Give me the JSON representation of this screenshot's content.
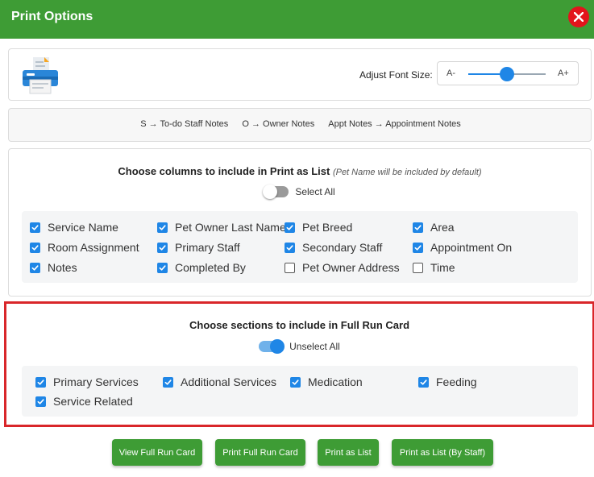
{
  "header": {
    "title": "Print Options"
  },
  "font_size": {
    "label": "Adjust Font Size:",
    "min_label": "A-",
    "max_label": "A+",
    "level": 0.5
  },
  "legend": [
    "S → To-do Staff Notes",
    "O → Owner Notes",
    "Appt Notes → Appointment Notes"
  ],
  "columns_section": {
    "title": "Choose columns to include in Print as List",
    "note": "(Pet Name will be included by default)",
    "toggle_label": "Select All",
    "toggle_on": false,
    "options": [
      {
        "label": "Service Name",
        "checked": true
      },
      {
        "label": "Pet Owner Last Name",
        "checked": true
      },
      {
        "label": "Pet Breed",
        "checked": true
      },
      {
        "label": "Area",
        "checked": true
      },
      {
        "label": "Room Assignment",
        "checked": true
      },
      {
        "label": "Primary Staff",
        "checked": true
      },
      {
        "label": "Secondary Staff",
        "checked": true
      },
      {
        "label": "Appointment On",
        "checked": true
      },
      {
        "label": "Notes",
        "checked": true
      },
      {
        "label": "Completed By",
        "checked": true
      },
      {
        "label": "Pet Owner Address",
        "checked": false
      },
      {
        "label": "Time",
        "checked": false
      }
    ]
  },
  "run_card_section": {
    "title": "Choose sections to include in Full Run Card",
    "toggle_label": "Unselect All",
    "toggle_on": true,
    "options": [
      {
        "label": "Primary Services",
        "checked": true
      },
      {
        "label": "Additional Services",
        "checked": true
      },
      {
        "label": "Medication",
        "checked": true
      },
      {
        "label": "Feeding",
        "checked": true
      },
      {
        "label": "Service Related",
        "checked": true
      }
    ]
  },
  "buttons": {
    "view_full_run_card": "View Full Run Card",
    "print_full_run_card": "Print Full Run Card",
    "print_as_list": "Print as List",
    "print_as_list_by_staff": "Print as List (By Staff)"
  },
  "colors": {
    "header": "#3e9c35",
    "accent": "#1f86e6",
    "close": "#e3141c",
    "highlight_border": "#d9262a"
  }
}
